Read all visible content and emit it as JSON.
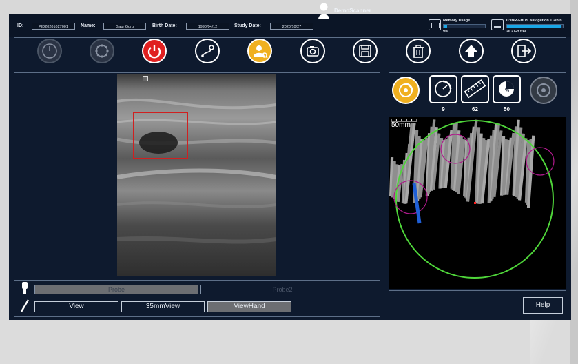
{
  "patient": {
    "id_label": "ID:",
    "id_value": "PID20201027001",
    "name_label": "Name:",
    "name_value": "Gaur Guru",
    "birth_label": "Birth Date:",
    "birth_value": "1990/04/12",
    "study_label": "Study Date:",
    "study_value": "2020/10/27"
  },
  "user": "DemoScanner",
  "status": {
    "memory_label": "Memory Usage",
    "memory_fraction": 0.08,
    "memory_sub": "9%",
    "disk_label": "C:/BR-FHUS Navigation 1.2/bin",
    "disk_fraction": 0.96,
    "disk_sub": "20.2 GB free.",
    "bar_color": "#19a6e6"
  },
  "toolbar": {
    "icons": [
      "gauge-icon",
      "ring-icon",
      "power-icon",
      "route-icon",
      "user-search-icon",
      "camera-icon",
      "save-icon",
      "trash-icon",
      "upload-arrow-icon",
      "exit-icon"
    ],
    "colors": {
      "power": "#e02020",
      "active": "#f0b020"
    }
  },
  "probe": {
    "probe1": "Probe",
    "probe2": "Probe2"
  },
  "views": {
    "view": "View",
    "mm35": "35mmView",
    "hand": "ViewHand"
  },
  "stats": {
    "count1": "9",
    "count2": "62",
    "count3": "50",
    "icons": [
      "scan-disc-icon",
      "rotate-gauge-icon",
      "ruler-icon",
      "percent-pie-icon",
      "disc-off-icon"
    ]
  },
  "map": {
    "scale_label": "50mm",
    "accent_colors": {
      "boundary": "#4fd63a",
      "region": "#b01a8c",
      "probe": "#1f5fd6",
      "marker": "#ff2020"
    }
  },
  "help_label": "Help"
}
